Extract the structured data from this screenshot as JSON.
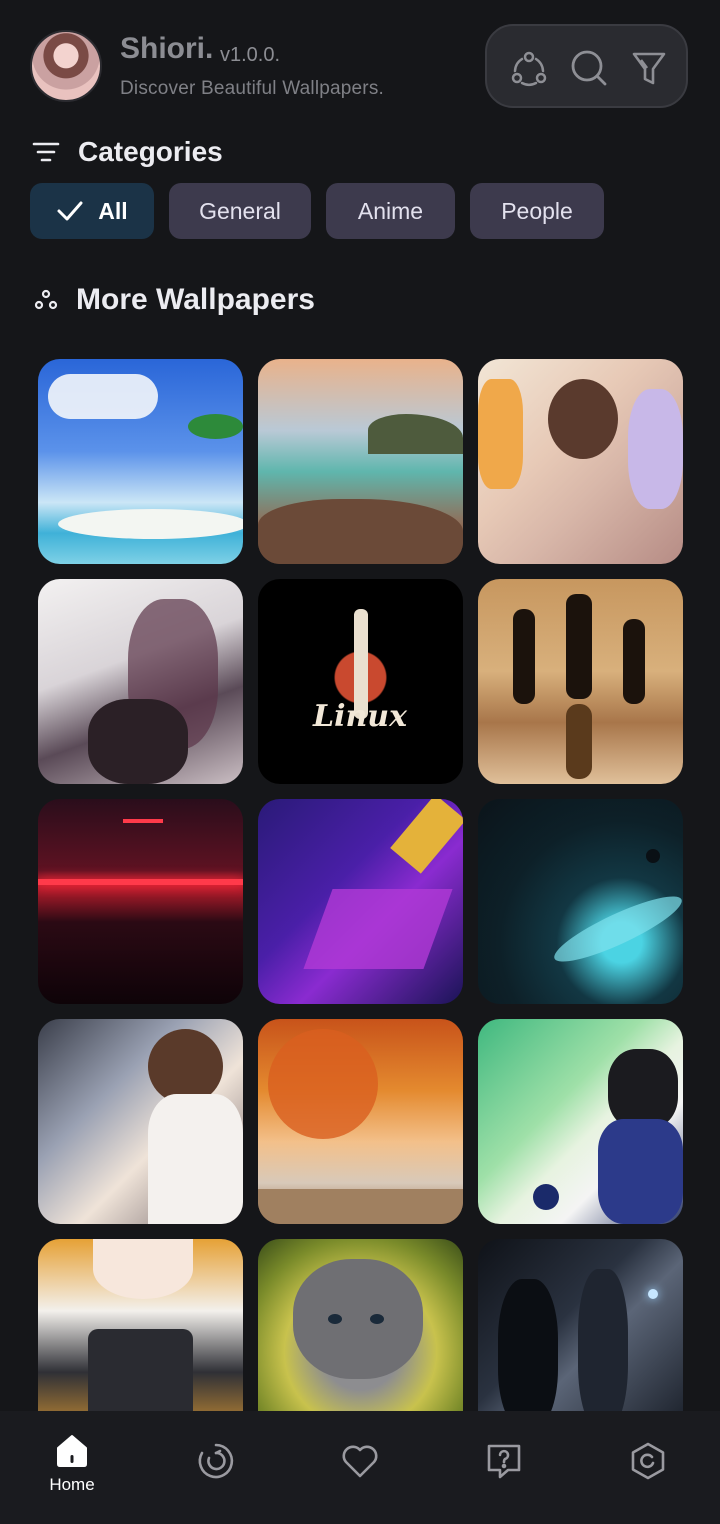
{
  "header": {
    "app_name": "Shiori.",
    "version": "v1.0.0.",
    "subtitle": "Discover Beautiful Wallpapers.",
    "tools": [
      {
        "icon": "share-nodes-icon"
      },
      {
        "icon": "search-icon"
      },
      {
        "icon": "filter-icon"
      }
    ]
  },
  "categories": {
    "title": "Categories",
    "items": [
      {
        "label": "All",
        "active": true
      },
      {
        "label": "General",
        "active": false
      },
      {
        "label": "Anime",
        "active": false
      },
      {
        "label": "People",
        "active": false
      }
    ]
  },
  "more_wallpapers": {
    "title": "More Wallpapers",
    "tiles": [
      {
        "subject": "tropical island palm tree"
      },
      {
        "subject": "beach rocks sunset"
      },
      {
        "subject": "anime girls cafe"
      },
      {
        "subject": "anime girl white coat"
      },
      {
        "subject": "linux rocket logo",
        "text": "Linux"
      },
      {
        "subject": "chess pieces"
      },
      {
        "subject": "car tail lights"
      },
      {
        "subject": "retro synthwave abstract"
      },
      {
        "subject": "space planet ring"
      },
      {
        "subject": "woman white dress"
      },
      {
        "subject": "autumn orange trees"
      },
      {
        "subject": "anime fighter"
      },
      {
        "subject": "anime girl maid"
      },
      {
        "subject": "grey kitten"
      },
      {
        "subject": "armored soldiers"
      }
    ]
  },
  "bottom_nav": [
    {
      "icon": "home-icon",
      "label": "Home",
      "active": true
    },
    {
      "icon": "refresh-icon",
      "label": "",
      "active": false
    },
    {
      "icon": "heart-icon",
      "label": "",
      "active": false
    },
    {
      "icon": "help-chat-icon",
      "label": "",
      "active": false
    },
    {
      "icon": "settings-hex-icon",
      "label": "",
      "active": false
    }
  ],
  "colors": {
    "background": "#151619",
    "chip": "#3d3a4d",
    "chip_active": "#1b3347",
    "nav": "#1a1b1f"
  }
}
